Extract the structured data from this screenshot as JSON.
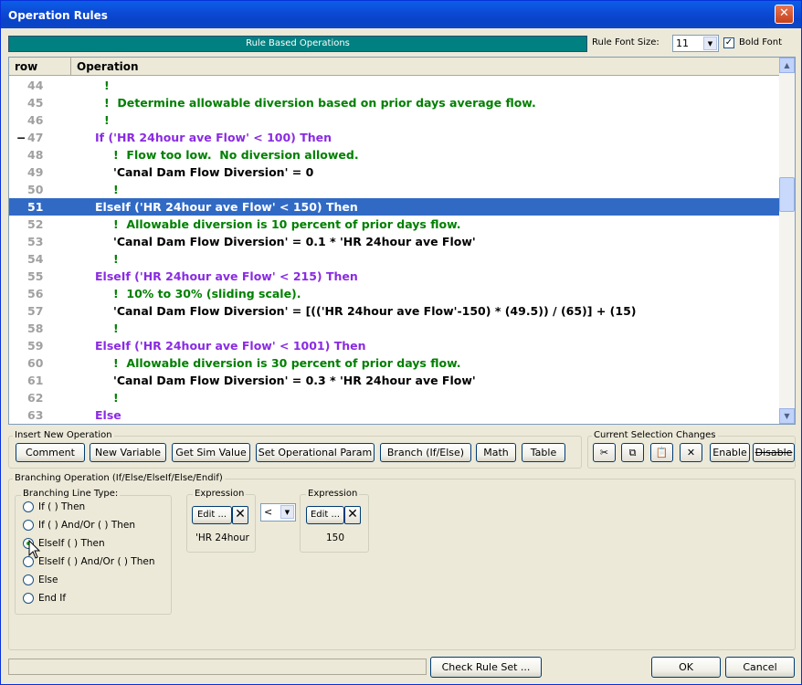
{
  "window": {
    "title": "Operation Rules",
    "close_glyph": "✕"
  },
  "banner": "Rule Based Operations",
  "font_size_label": "Rule Font Size:",
  "font_size_value": "11",
  "bold_font_label": "Bold Font",
  "bold_font_checked": true,
  "grid": {
    "col_row": "row",
    "col_operation": "Operation",
    "rows": [
      {
        "n": "44",
        "indent": 1,
        "kind": "comment",
        "text": "!"
      },
      {
        "n": "45",
        "indent": 1,
        "kind": "comment",
        "text": "!  Determine allowable diversion based on prior days average flow."
      },
      {
        "n": "46",
        "indent": 1,
        "kind": "comment",
        "text": "!"
      },
      {
        "n": "47",
        "indent": 0,
        "kind": "branch",
        "text": "If ('HR 24hour ave Flow' < 100) Then",
        "marker": "−"
      },
      {
        "n": "48",
        "indent": 2,
        "kind": "comment",
        "text": "!  Flow too low.  No diversion allowed."
      },
      {
        "n": "49",
        "indent": 2,
        "kind": "stmt",
        "text": "'Canal Dam Flow Diversion' = 0"
      },
      {
        "n": "50",
        "indent": 2,
        "kind": "comment",
        "text": "!"
      },
      {
        "n": "51",
        "indent": 0,
        "kind": "branch",
        "text": "ElseIf ('HR 24hour ave Flow' < 150) Then",
        "selected": true
      },
      {
        "n": "52",
        "indent": 2,
        "kind": "comment",
        "text": "!  Allowable diversion is 10 percent of prior days flow."
      },
      {
        "n": "53",
        "indent": 2,
        "kind": "stmt",
        "text": "'Canal Dam Flow Diversion' = 0.1 * 'HR 24hour ave Flow'"
      },
      {
        "n": "54",
        "indent": 2,
        "kind": "comment",
        "text": "!"
      },
      {
        "n": "55",
        "indent": 0,
        "kind": "branch",
        "text": "ElseIf ('HR 24hour ave Flow' < 215) Then"
      },
      {
        "n": "56",
        "indent": 2,
        "kind": "comment",
        "text": "!  10% to 30% (sliding scale)."
      },
      {
        "n": "57",
        "indent": 2,
        "kind": "stmt",
        "text": "'Canal Dam Flow Diversion' = [(('HR 24hour ave Flow'-150) * (49.5)) / (65)] + (15)"
      },
      {
        "n": "58",
        "indent": 2,
        "kind": "comment",
        "text": "!"
      },
      {
        "n": "59",
        "indent": 0,
        "kind": "branch",
        "text": "ElseIf ('HR 24hour ave Flow' < 1001) Then"
      },
      {
        "n": "60",
        "indent": 2,
        "kind": "comment",
        "text": "!  Allowable diversion is 30 percent of prior days flow."
      },
      {
        "n": "61",
        "indent": 2,
        "kind": "stmt",
        "text": "'Canal Dam Flow Diversion' = 0.3 * 'HR 24hour ave Flow'"
      },
      {
        "n": "62",
        "indent": 2,
        "kind": "comment",
        "text": "!"
      },
      {
        "n": "63",
        "indent": 0,
        "kind": "branch",
        "text": "Else"
      }
    ]
  },
  "colors": {
    "comment": "#008000",
    "branch": "#8a2be2",
    "stmt": "#000000",
    "selected_bg": "#316ac5"
  },
  "insert_group": {
    "legend": "Insert New Operation",
    "buttons": [
      "Comment",
      "New Variable",
      "Get Sim Value",
      "Set Operational Param",
      "Branch (If/Else)",
      "Math",
      "Table"
    ]
  },
  "selection_group": {
    "legend": "Current Selection Changes",
    "enable": "Enable",
    "disable": "Disable"
  },
  "branching": {
    "legend": "Branching Operation (If/Else/ElseIf/Else/Endif)",
    "line_type_legend": "Branching Line Type:",
    "options": [
      "If  (  )  Then",
      "If  (  )  And/Or  (  )  Then",
      "ElseIf  (  )  Then",
      "ElseIf  (  )  And/Or  (  )  Then",
      "Else",
      "End If"
    ],
    "selected_index": 2,
    "expr1": {
      "legend": "Expression",
      "edit": "Edit ...",
      "value": "'HR 24hour"
    },
    "operator": "<",
    "expr2": {
      "legend": "Expression",
      "edit": "Edit ...",
      "value": "150"
    }
  },
  "footer": {
    "check": "Check Rule Set ...",
    "ok": "OK",
    "cancel": "Cancel"
  }
}
